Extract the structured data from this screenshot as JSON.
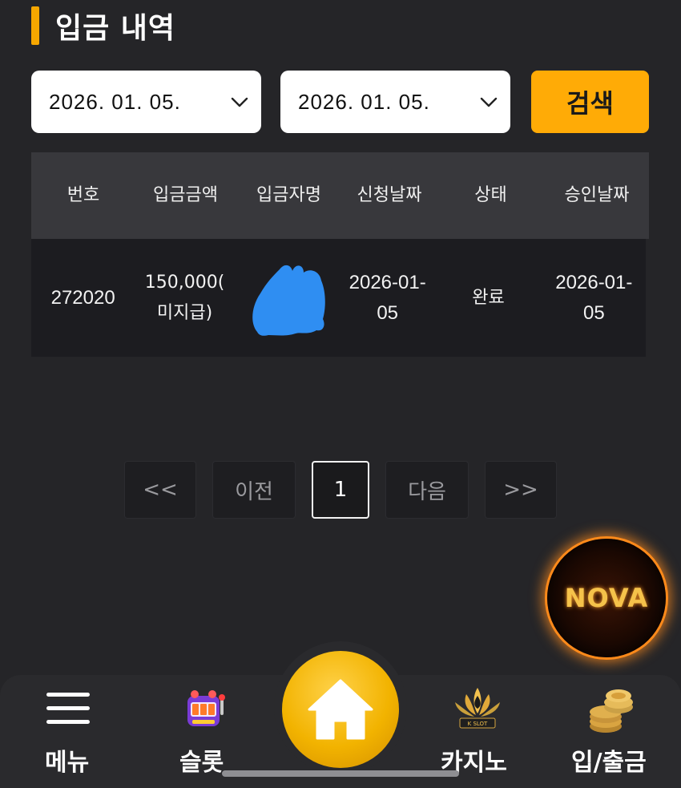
{
  "page": {
    "title": "입금 내역"
  },
  "filters": {
    "date_from": "2026. 01. 05.",
    "date_to": "2026. 01. 05.",
    "search_label": "검색"
  },
  "table": {
    "headers": [
      "번호",
      "입금금액",
      "입금자명",
      "신청날짜",
      "상태",
      "승인날짜"
    ],
    "rows": [
      {
        "number": "272020",
        "amount_line1": "150,000(",
        "amount_line2": "미지급)",
        "depositor": "",
        "request_date_line1": "2026-01-",
        "request_date_line2": "05",
        "status": "완료",
        "approve_date_line1": "2026-01-",
        "approve_date_line2": "05"
      }
    ]
  },
  "pagination": {
    "first": "<<",
    "prev": "이전",
    "current": "1",
    "next": "다음",
    "last": ">>"
  },
  "floating_badge": {
    "text": "NOVA"
  },
  "bottom_nav": {
    "menu": "메뉴",
    "slot": "슬롯",
    "casino": "카지노",
    "deposit_withdraw": "입/출금",
    "casino_badge_text": "K SLOT"
  },
  "colors": {
    "accent": "#ffab06",
    "background": "#252528",
    "redaction_blue": "#2f8ef2"
  }
}
